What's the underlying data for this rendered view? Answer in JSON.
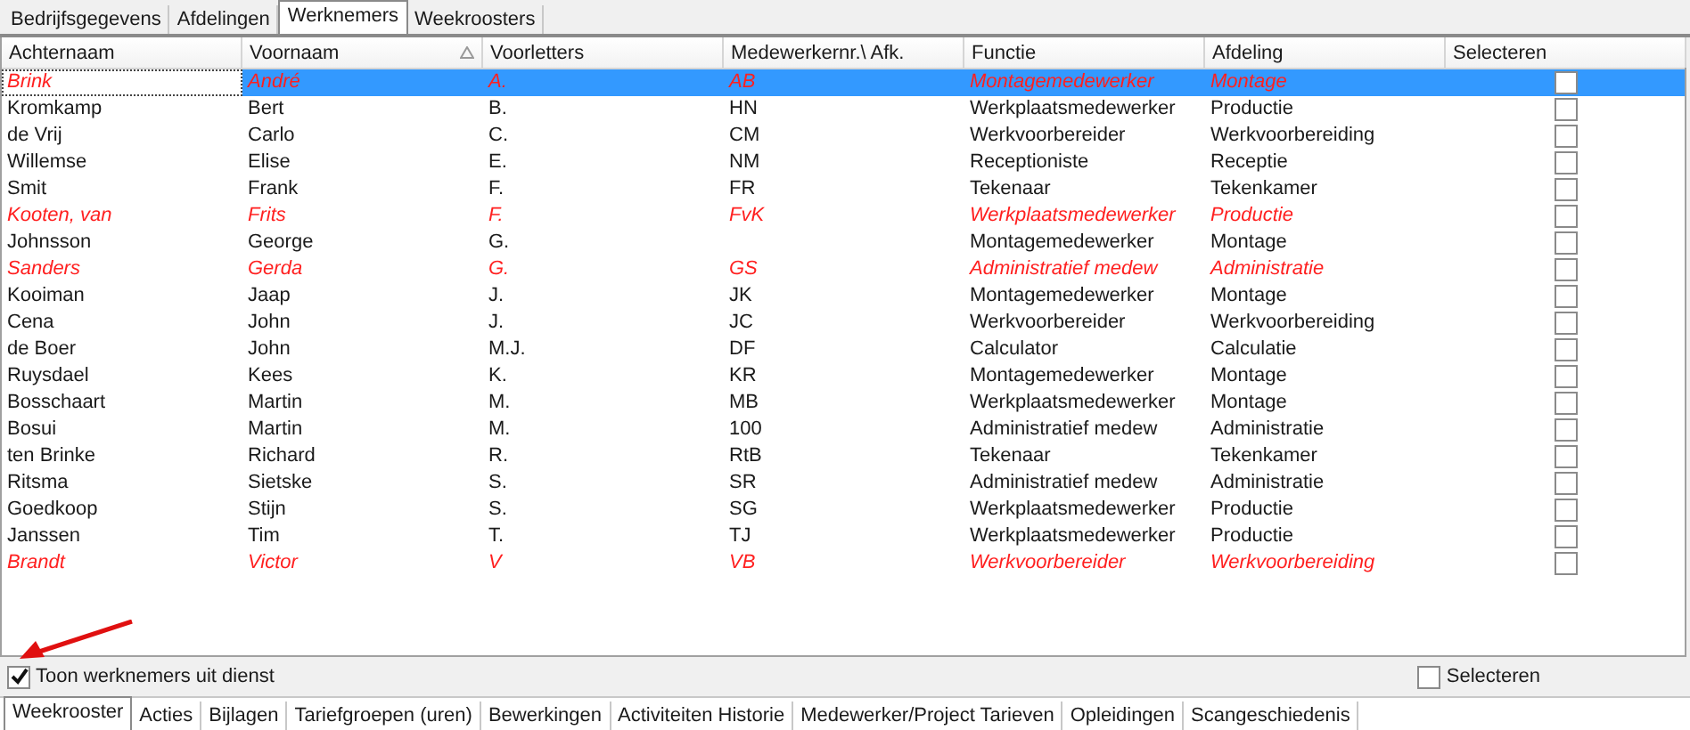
{
  "top_tabs": [
    {
      "label": "Bedrijfsgegevens",
      "selected": false
    },
    {
      "label": "Afdelingen",
      "selected": false
    },
    {
      "label": "Werknemers",
      "selected": true
    },
    {
      "label": "Weekroosters",
      "selected": false
    }
  ],
  "table": {
    "columns": [
      {
        "label": "Achternaam",
        "sorted": false
      },
      {
        "label": "Voornaam",
        "sorted": true
      },
      {
        "label": "Voorletters",
        "sorted": false
      },
      {
        "label": "Medewerkernr.\\ Afk.",
        "sorted": false
      },
      {
        "label": "Functie",
        "sorted": false
      },
      {
        "label": "Afdeling",
        "sorted": false
      },
      {
        "label": "Selecteren",
        "sorted": false
      }
    ],
    "rows": [
      {
        "cells": [
          "Brink",
          "André",
          "A.",
          "AB",
          "Montagemedewerker",
          "Montage"
        ],
        "out_of_service": true,
        "selected": true,
        "checked": false
      },
      {
        "cells": [
          "Kromkamp",
          "Bert",
          "B.",
          "HN",
          "Werkplaatsmedewerker",
          "Productie"
        ],
        "out_of_service": false,
        "selected": false,
        "checked": false
      },
      {
        "cells": [
          "de Vrij",
          "Carlo",
          "C.",
          "CM",
          "Werkvoorbereider",
          "Werkvoorbereiding"
        ],
        "out_of_service": false,
        "selected": false,
        "checked": false
      },
      {
        "cells": [
          "Willemse",
          "Elise",
          "E.",
          "NM",
          "Receptioniste",
          "Receptie"
        ],
        "out_of_service": false,
        "selected": false,
        "checked": false
      },
      {
        "cells": [
          "Smit",
          "Frank",
          "F.",
          "FR",
          "Tekenaar",
          "Tekenkamer"
        ],
        "out_of_service": false,
        "selected": false,
        "checked": false
      },
      {
        "cells": [
          "Kooten, van",
          "Frits",
          "F.",
          "FvK",
          "Werkplaatsmedewerker",
          "Productie"
        ],
        "out_of_service": true,
        "selected": false,
        "checked": false
      },
      {
        "cells": [
          "Johnsson",
          "George",
          "G.",
          "",
          "Montagemedewerker",
          "Montage"
        ],
        "out_of_service": false,
        "selected": false,
        "checked": false
      },
      {
        "cells": [
          "Sanders",
          "Gerda",
          "G.",
          "GS",
          "Administratief medew",
          "Administratie"
        ],
        "out_of_service": true,
        "selected": false,
        "checked": false
      },
      {
        "cells": [
          "Kooiman",
          "Jaap",
          "J.",
          "JK",
          "Montagemedewerker",
          "Montage"
        ],
        "out_of_service": false,
        "selected": false,
        "checked": false
      },
      {
        "cells": [
          "Cena",
          "John",
          "J.",
          "JC",
          "Werkvoorbereider",
          "Werkvoorbereiding"
        ],
        "out_of_service": false,
        "selected": false,
        "checked": false
      },
      {
        "cells": [
          "de Boer",
          "John",
          "M.J.",
          "DF",
          "Calculator",
          "Calculatie"
        ],
        "out_of_service": false,
        "selected": false,
        "checked": false
      },
      {
        "cells": [
          "Ruysdael",
          "Kees",
          "K.",
          "KR",
          "Montagemedewerker",
          "Montage"
        ],
        "out_of_service": false,
        "selected": false,
        "checked": false
      },
      {
        "cells": [
          "Bosschaart",
          "Martin",
          "M.",
          "MB",
          "Werkplaatsmedewerker",
          "Montage"
        ],
        "out_of_service": false,
        "selected": false,
        "checked": false
      },
      {
        "cells": [
          "Bosui",
          "Martin",
          "M.",
          "100",
          "Administratief medew",
          "Administratie"
        ],
        "out_of_service": false,
        "selected": false,
        "checked": false
      },
      {
        "cells": [
          "ten Brinke",
          "Richard",
          "R.",
          "RtB",
          "Tekenaar",
          "Tekenkamer"
        ],
        "out_of_service": false,
        "selected": false,
        "checked": false
      },
      {
        "cells": [
          "Ritsma",
          "Sietske",
          "S.",
          "SR",
          "Administratief medew",
          "Administratie"
        ],
        "out_of_service": false,
        "selected": false,
        "checked": false
      },
      {
        "cells": [
          "Goedkoop",
          "Stijn",
          "S.",
          "SG",
          "Werkplaatsmedewerker",
          "Productie"
        ],
        "out_of_service": false,
        "selected": false,
        "checked": false
      },
      {
        "cells": [
          "Janssen",
          "Tim",
          "T.",
          "TJ",
          "Werkplaatsmedewerker",
          "Productie"
        ],
        "out_of_service": false,
        "selected": false,
        "checked": false
      },
      {
        "cells": [
          "Brandt",
          "Victor",
          "V",
          "VB",
          "Werkvoorbereider",
          "Werkvoorbereiding"
        ],
        "out_of_service": true,
        "selected": false,
        "checked": false
      }
    ]
  },
  "show_inactive": {
    "label": "Toon werknemers uit dienst",
    "checked": true
  },
  "select_all": {
    "label": "Selecteren",
    "checked": false
  },
  "bottom_tabs": [
    {
      "label": "Weekrooster",
      "selected": true
    },
    {
      "label": "Acties",
      "selected": false
    },
    {
      "label": "Bijlagen",
      "selected": false
    },
    {
      "label": "Tariefgroepen (uren)",
      "selected": false
    },
    {
      "label": "Bewerkingen",
      "selected": false
    },
    {
      "label": "Activiteiten Historie",
      "selected": false
    },
    {
      "label": "Medewerker/Project Tarieven",
      "selected": false
    },
    {
      "label": "Opleidingen",
      "selected": false
    },
    {
      "label": "Scangeschiedenis",
      "selected": false
    }
  ]
}
